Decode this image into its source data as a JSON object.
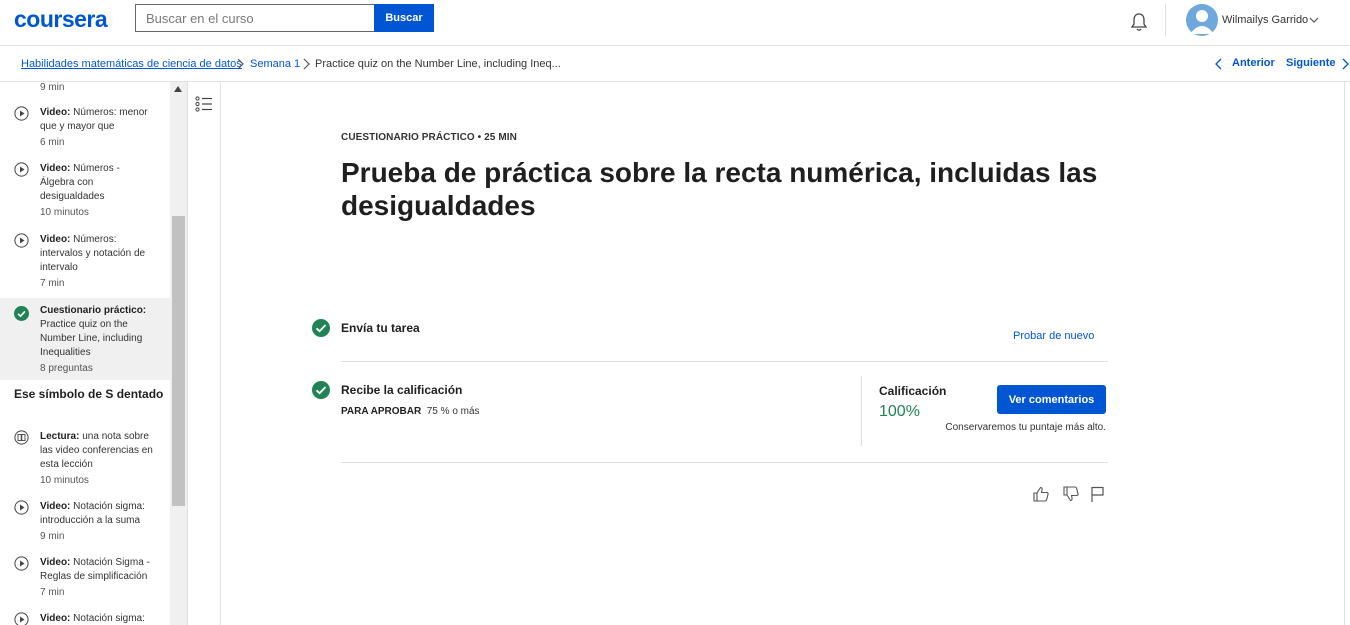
{
  "header": {
    "logo": "coursera",
    "search_placeholder": "Buscar en el curso",
    "search_button": "Buscar",
    "user_name": "Wilmailys Garrido"
  },
  "breadcrumb": {
    "items": [
      "Habilidades matemáticas de ciencia de datos",
      "Semana 1",
      "Practice quiz on the Number Line, including Ineq..."
    ],
    "prev": "Anterior",
    "next": "Siguiente"
  },
  "sidebar": {
    "items": [
      {
        "duration": "9 min"
      },
      {
        "type": "Video:",
        "title": "Números: menor que y mayor que",
        "duration": "6 min"
      },
      {
        "type": "Video:",
        "title": "Números - Álgebra con desigualdades",
        "duration": "10 minutos"
      },
      {
        "type": "Video:",
        "title": "Números: intervalos y notación de intervalo",
        "duration": "7 min"
      },
      {
        "type": "Cuestionario práctico:",
        "title": "Practice quiz on the Number Line, including Inequalities",
        "duration": "8 preguntas"
      },
      {
        "type": "Lectura:",
        "title": "una nota sobre las video conferencias en esta lección",
        "duration": "10 minutos"
      },
      {
        "type": "Video:",
        "title": "Notación sigma: introducción a la suma",
        "duration": "9 min"
      },
      {
        "type": "Video:",
        "title": "Notación Sigma - Reglas de simplificación",
        "duration": "7 min"
      },
      {
        "type": "Video:",
        "title": "Notación sigma:",
        "duration": ""
      }
    ],
    "section_heading": "Ese símbolo de S dentado"
  },
  "main": {
    "eyebrow": "CUESTIONARIO PRÁCTICO • 25 MIN",
    "title": "Prueba de práctica sobre la recta numérica, incluidas las desigualdades",
    "step1_title": "Envía tu tarea",
    "retry": "Probar de nuevo",
    "step2_title": "Recibe la calificación",
    "pass_label": "PARA APROBAR",
    "pass_value": "75 % o más",
    "grade_label": "Calificación",
    "grade_value": "100%",
    "feedback_button": "Ver comentarios",
    "keep_note": "Conservaremos tu puntaje más alto."
  },
  "colors": {
    "brand": "#0056d2",
    "success": "#1f8354",
    "sidebar_active": "#f0f0f0"
  },
  "icons": [
    "bell-icon",
    "avatar-icon",
    "chevron-down-icon",
    "chevron-right-icon",
    "chevron-left-icon",
    "play-icon",
    "check-circle-icon",
    "reading-icon",
    "list-icon",
    "thumbs-up-icon",
    "thumbs-down-icon",
    "flag-icon"
  ]
}
